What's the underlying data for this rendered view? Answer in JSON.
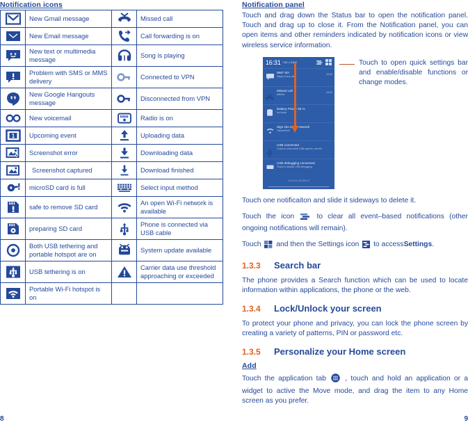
{
  "left": {
    "title": "Notification icons",
    "page_number": "8",
    "rows": [
      {
        "left_icon": "gmail-icon",
        "left_label": "New Gmail message",
        "right_icon": "missed-call-icon",
        "right_label": "Missed call"
      },
      {
        "left_icon": "email-icon",
        "left_label": "New Email message",
        "right_icon": "call-forwarding-icon",
        "right_label": "Call forwarding is on"
      },
      {
        "left_icon": "sms-mms-icon",
        "left_label": "New text or multimedia message",
        "right_icon": "headphones-icon",
        "right_label": "Song is playing"
      },
      {
        "left_icon": "sms-problem-icon",
        "left_label": "Problem with SMS or MMS delivery",
        "right_icon": "vpn-connected-icon",
        "right_label": "Connected to VPN"
      },
      {
        "left_icon": "hangouts-icon",
        "left_label": "New Google Hangouts message",
        "right_icon": "vpn-disconnected-icon",
        "right_label": "Disconnected from VPN"
      },
      {
        "left_icon": "voicemail-icon",
        "left_label": "New voicemail",
        "right_icon": "radio-icon",
        "right_label": "Radio is on"
      },
      {
        "left_icon": "calendar-event-icon",
        "left_label": "Upcoming event",
        "right_icon": "upload-icon",
        "right_label": "Uploading data"
      },
      {
        "left_icon": "screenshot-error-icon",
        "left_label": "Screenshot error",
        "right_icon": "download-icon",
        "right_label": "Downloading data"
      },
      {
        "left_icon": "screenshot-captured-icon",
        "left_label": "Screenshot captured",
        "right_icon": "download-finished-icon",
        "right_label": "Download finished"
      },
      {
        "left_icon": "microsd-full-icon",
        "left_label": "microSD card is full",
        "right_icon": "keyboard-icon",
        "right_label": "Select input method"
      },
      {
        "left_icon": "sd-safe-remove-icon",
        "left_label": "safe to remove SD card",
        "right_icon": "wifi-open-icon",
        "right_label": "An open Wi-Fi network is available"
      },
      {
        "left_icon": "sd-preparing-icon",
        "left_label": "preparing SD card",
        "right_icon": "usb-icon",
        "right_label": "Phone is connected via USB cable"
      },
      {
        "left_icon": "usb-tether-hotspot-icon",
        "left_label": "Both USB tethering and portable hotspot are on",
        "right_icon": "android-update-icon",
        "right_label": "System update available"
      },
      {
        "left_icon": "usb-tethering-icon",
        "left_label": "USB tethering is on",
        "right_icon": "warning-icon",
        "right_label": "Carrier data use threshold approaching or exceeded"
      },
      {
        "left_icon": "wifi-hotspot-icon",
        "left_label": "Portable Wi-Fi hotspot is on",
        "right_icon": "",
        "right_label": ""
      }
    ]
  },
  "right": {
    "title": "Notification panel",
    "page_number": "9",
    "intro": "Touch and drag down the Status bar to open the notification panel. Touch and drag up to close it. From the Notification panel, you can open items and other reminders indicated by notification icons or view wireless service information.",
    "callout": "Touch to open quick settings bar and enable/disable functions or change modes.",
    "phone": {
      "status_time": "16:31",
      "status_date": "TUE 4 JUNE",
      "notifications": [
        {
          "title": "9987 50!",
          "subtitle": "Happy every day",
          "time": "16:30",
          "icon": "message-icon"
        },
        {
          "title": "Missed call",
          "subtitle": "666401",
          "time": "16:29",
          "icon": "missed-call-icon"
        },
        {
          "title": "Battery Power 56 %",
          "subtitle": "No Mode",
          "time": "",
          "icon": "battery-icon"
        },
        {
          "title": "Sign into Wi-Fi network",
          "subtitle": "\"MobileTest\"",
          "time": "",
          "icon": "wifi-icon"
        },
        {
          "title": "USB connected",
          "subtitle": "Touch to show other USB options, and etc",
          "time": "",
          "icon": "usb-icon"
        },
        {
          "title": "USB debugging connected",
          "subtitle": "Touch to disable USB debugging",
          "time": "",
          "icon": "usb-debug-icon"
        }
      ],
      "footer": "CHINA MOBILE"
    },
    "para_delete": "Touch one notificaiton and slide it sideways to delete it.",
    "para_clear_pre": "Touch the icon",
    "para_clear_post": "to clear all event–based notifications (other ongoing notifications will remain).",
    "para_settings_pre": "Touch",
    "para_settings_mid": "and then the Settings icon",
    "para_settings_post": "to access",
    "para_settings_bold": "Settings",
    "para_settings_end": ".",
    "sections": [
      {
        "number": "1.3.3",
        "title": "Search bar",
        "body": "The phone provides a Search function which can be used to locate information within applications, the phone or the web."
      },
      {
        "number": "1.3.4",
        "title": "Lock/Unlock your screen",
        "body": "To protect your phone and privacy, you can lock the phone screen by creating a variety of patterns, PIN or password etc."
      },
      {
        "number": "1.3.5",
        "title": "Personalize your Home screen",
        "sub_head": "Add",
        "body_pre": "Touch the application tab",
        "body_post": ", touch and hold an application or a widget to active the Move mode, and drag the item to any Home screen as you prefer."
      }
    ]
  },
  "colors": {
    "primary_blue": "#24499a",
    "accent_orange": "#e1611f",
    "phone_bg": "#2d5ca8"
  }
}
